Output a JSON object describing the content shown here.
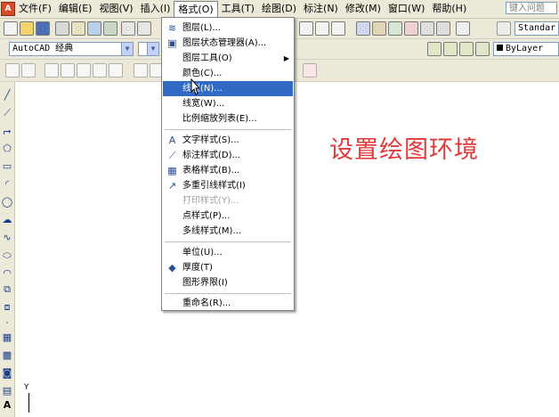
{
  "menubar": {
    "items": [
      {
        "label": "文件(F)"
      },
      {
        "label": "编辑(E)"
      },
      {
        "label": "视图(V)"
      },
      {
        "label": "插入(I)"
      },
      {
        "label": "格式(O)"
      },
      {
        "label": "工具(T)"
      },
      {
        "label": "绘图(D)"
      },
      {
        "label": "标注(N)"
      },
      {
        "label": "修改(M)"
      },
      {
        "label": "窗口(W)"
      },
      {
        "label": "帮助(H)"
      }
    ],
    "help_search": "键入问题"
  },
  "toolbar": {
    "workspace_combo": "AutoCAD 经典",
    "text_style_combo": "Standar",
    "linetype_combo": "ByLayer"
  },
  "format_menu": {
    "items": [
      {
        "label": "图层(L)...",
        "icon": "layers-icon"
      },
      {
        "label": "图层状态管理器(A)...",
        "icon": "layer-state-icon"
      },
      {
        "label": "图层工具(O)",
        "icon": "",
        "submenu": true
      },
      {
        "label": "颜色(C)...",
        "icon": ""
      },
      {
        "label": "线型(N)...",
        "icon": "",
        "selected": true
      },
      {
        "label": "线宽(W)...",
        "icon": ""
      },
      {
        "label": "比例缩放列表(E)...",
        "icon": ""
      },
      {
        "label": "文字样式(S)...",
        "icon": "text-style-icon"
      },
      {
        "label": "标注样式(D)...",
        "icon": "dim-style-icon"
      },
      {
        "label": "表格样式(B)...",
        "icon": "table-style-icon"
      },
      {
        "label": "多重引线样式(I)",
        "icon": "mleader-style-icon"
      },
      {
        "label": "打印样式(Y)...",
        "icon": "",
        "disabled": true
      },
      {
        "label": "点样式(P)...",
        "icon": ""
      },
      {
        "label": "多线样式(M)...",
        "icon": ""
      },
      {
        "label": "单位(U)...",
        "icon": ""
      },
      {
        "label": "厚度(T)",
        "icon": "thickness-icon"
      },
      {
        "label": "图形界限(I)",
        "icon": ""
      },
      {
        "label": "重命名(R)...",
        "icon": ""
      }
    ]
  },
  "canvas": {
    "title": "设置绘图环境",
    "ucs_label": "Y"
  },
  "colors": {
    "title_red": "#e03a3a",
    "selection_blue": "#316ac5"
  }
}
